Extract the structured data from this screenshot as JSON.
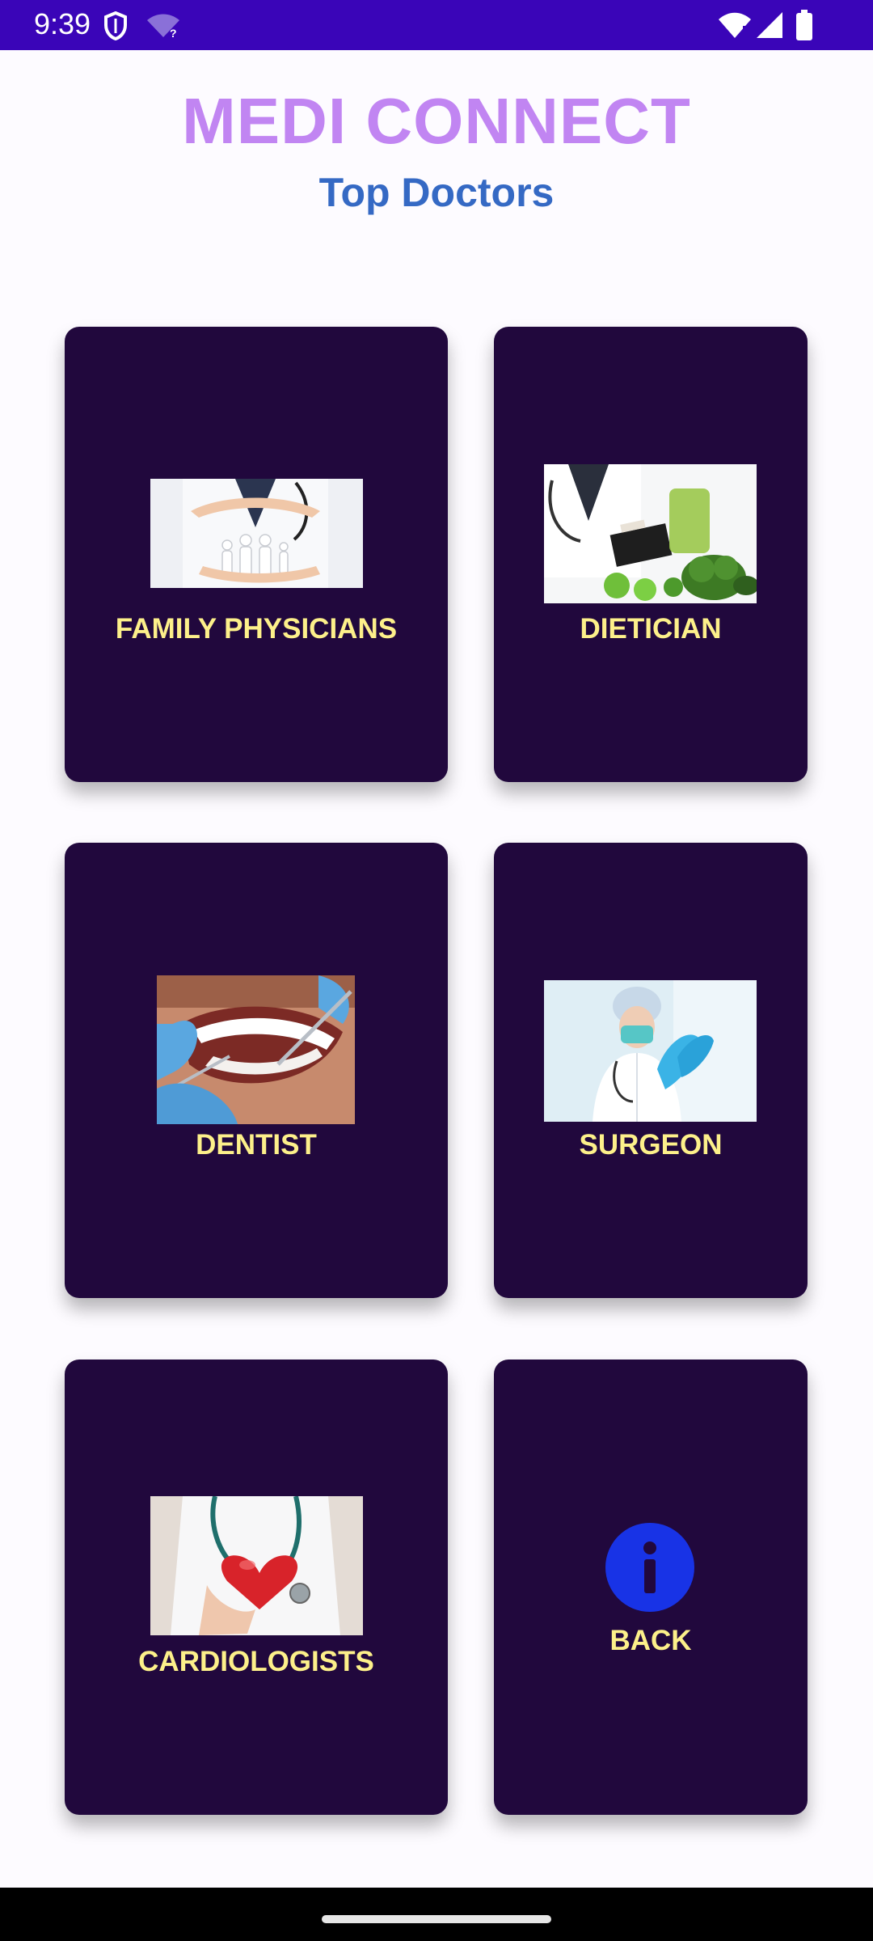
{
  "status_bar": {
    "time": "9:39",
    "icons": [
      "shield-icon",
      "wifi-unknown-icon",
      "wifi-icon",
      "signal-icon",
      "battery-icon"
    ],
    "color": "#3a05b8"
  },
  "header": {
    "title": "MEDI CONNECT",
    "subtitle": "Top Doctors",
    "title_color": "#c185f2",
    "subtitle_color": "#3569c4"
  },
  "cards": {
    "family": {
      "label": "FAMILY PHYSICIANS",
      "image": "family-physician-image"
    },
    "dietician": {
      "label": "DIETICIAN",
      "image": "dietician-image"
    },
    "dentist": {
      "label": "DENTIST",
      "image": "dentist-image"
    },
    "surgeon": {
      "label": "SURGEON",
      "image": "surgeon-image"
    },
    "cardiologists": {
      "label": "CARDIOLOGISTS",
      "image": "cardiologist-image"
    },
    "back": {
      "label": "BACK",
      "icon": "info-icon"
    }
  },
  "colors": {
    "card_background": "#21083d",
    "card_label": "#fdf08a",
    "info_icon": "#1833e6"
  }
}
